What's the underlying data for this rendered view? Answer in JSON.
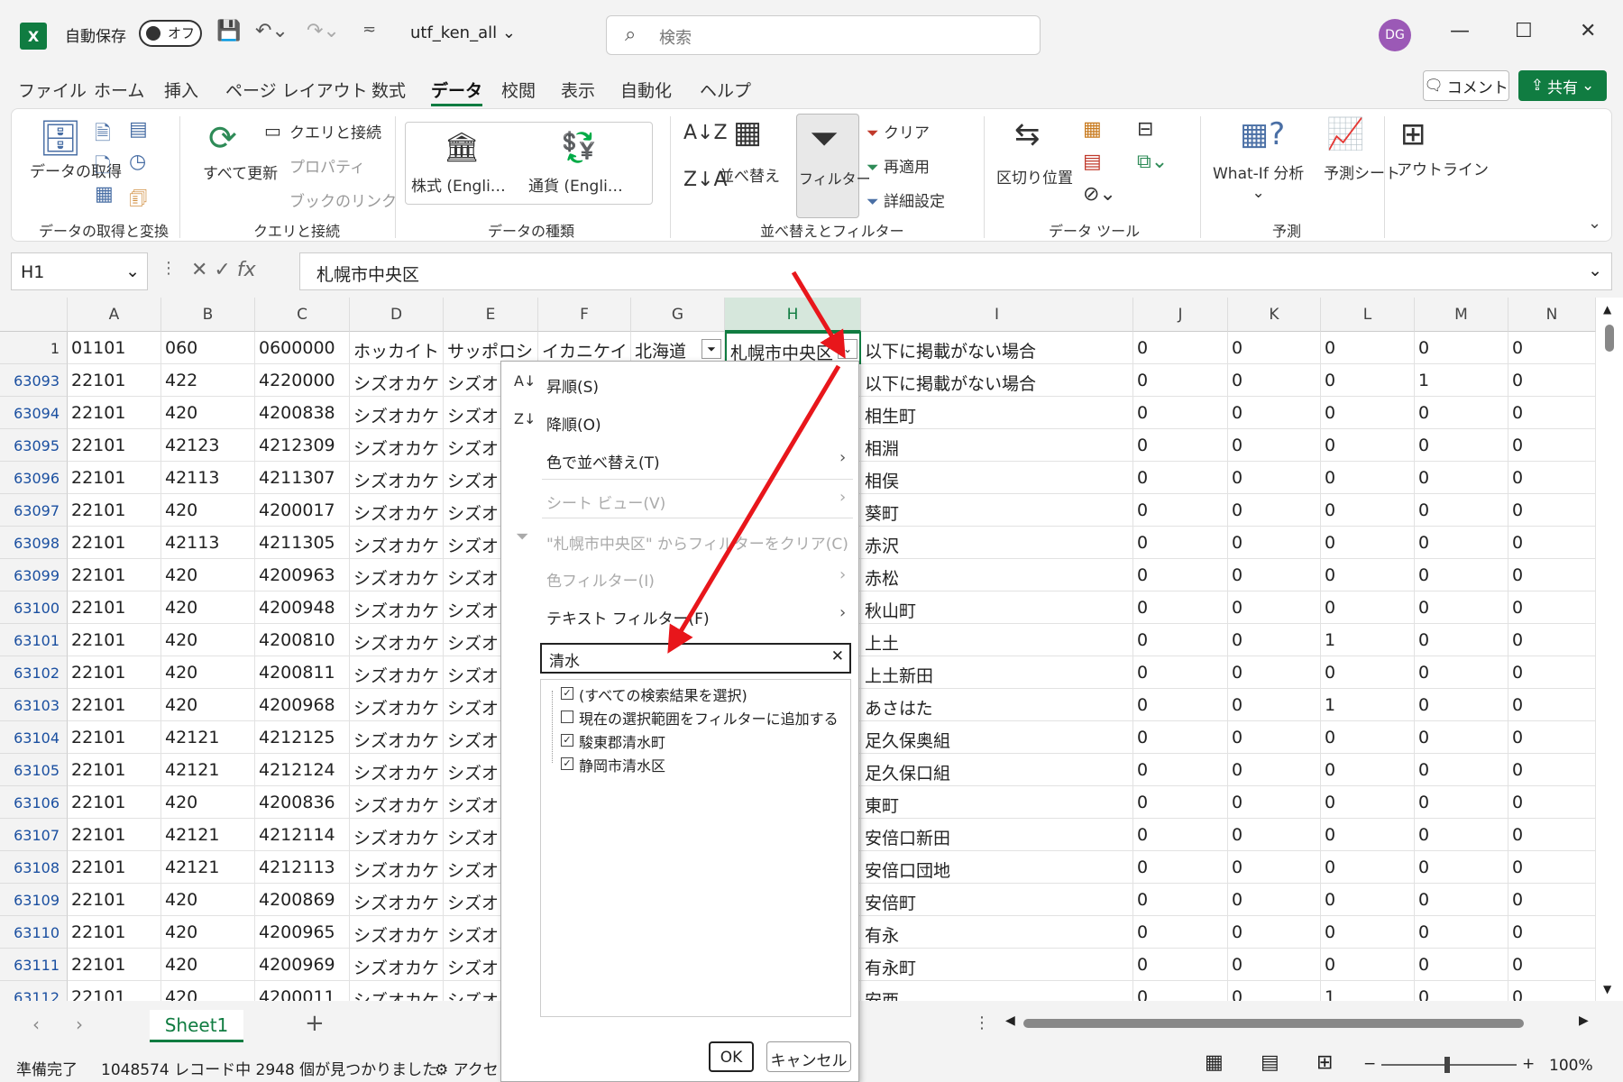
{
  "titlebar": {
    "autosave_label": "自動保存",
    "toggle_label": "オフ",
    "filename": "utf_ken_all",
    "search_placeholder": "検索",
    "avatar": "DG"
  },
  "menu": [
    "ファイル",
    "ホーム",
    "挿入",
    "ページ レイアウト",
    "数式",
    "データ",
    "校閲",
    "表示",
    "自動化",
    "ヘルプ"
  ],
  "menu_active": "データ",
  "buttons": {
    "comment": "コメント",
    "share": "共有"
  },
  "ribbon": {
    "groups": [
      "データの取得と変換",
      "クエリと接続",
      "データの種類",
      "並べ替えとフィルター",
      "データ ツール",
      "予測"
    ],
    "get_data": "データの取得",
    "refresh_all": "すべて更新",
    "queries": "クエリと接続",
    "properties": "プロパティ",
    "book_links": "ブックのリンク",
    "stocks": "株式 (Engli…",
    "currency": "通貨 (Engli…",
    "sort": "並べ替え",
    "filter": "フィルター",
    "clear": "クリア",
    "reapply": "再適用",
    "advanced": "詳細設定",
    "text_to_columns": "区切り位置",
    "whatif": "What-If 分析",
    "forecast": "予測シート",
    "outline": "アウトライン"
  },
  "formula_bar": {
    "name_box": "H1",
    "content": "札幌市中央区"
  },
  "columns": [
    "A",
    "B",
    "C",
    "D",
    "E",
    "F",
    "G",
    "H",
    "I",
    "J",
    "K",
    "L",
    "M",
    "N"
  ],
  "header_row": {
    "num": "1",
    "cells": [
      "01101",
      "060",
      "0600000",
      "ホッカイト",
      "サッポロシ",
      "イカニケイ",
      "北海道",
      "札幌市中央区",
      "以下に掲載がない場合",
      "0",
      "0",
      "0",
      "0",
      "0"
    ]
  },
  "rows": [
    {
      "num": "63093",
      "a": "22101",
      "b": "422",
      "c": "4220000",
      "d": "シズオカケ",
      "e": "シズオ",
      "i": "以下に掲載がない場合",
      "j": "0",
      "k": "0",
      "l": "0",
      "m": "1",
      "n": "0"
    },
    {
      "num": "63094",
      "a": "22101",
      "b": "420",
      "c": "4200838",
      "d": "シズオカケ",
      "e": "シズオ",
      "i": "相生町",
      "j": "0",
      "k": "0",
      "l": "0",
      "m": "0",
      "n": "0"
    },
    {
      "num": "63095",
      "a": "22101",
      "b": "42123",
      "c": "4212309",
      "d": "シズオカケ",
      "e": "シズオ",
      "i": "相淵",
      "j": "0",
      "k": "0",
      "l": "0",
      "m": "0",
      "n": "0"
    },
    {
      "num": "63096",
      "a": "22101",
      "b": "42113",
      "c": "4211307",
      "d": "シズオカケ",
      "e": "シズオ",
      "i": "相俣",
      "j": "0",
      "k": "0",
      "l": "0",
      "m": "0",
      "n": "0"
    },
    {
      "num": "63097",
      "a": "22101",
      "b": "420",
      "c": "4200017",
      "d": "シズオカケ",
      "e": "シズオ",
      "i": "葵町",
      "j": "0",
      "k": "0",
      "l": "0",
      "m": "0",
      "n": "0"
    },
    {
      "num": "63098",
      "a": "22101",
      "b": "42113",
      "c": "4211305",
      "d": "シズオカケ",
      "e": "シズオ",
      "i": "赤沢",
      "j": "0",
      "k": "0",
      "l": "0",
      "m": "0",
      "n": "0"
    },
    {
      "num": "63099",
      "a": "22101",
      "b": "420",
      "c": "4200963",
      "d": "シズオカケ",
      "e": "シズオ",
      "i": "赤松",
      "j": "0",
      "k": "0",
      "l": "0",
      "m": "0",
      "n": "0"
    },
    {
      "num": "63100",
      "a": "22101",
      "b": "420",
      "c": "4200948",
      "d": "シズオカケ",
      "e": "シズオ",
      "i": "秋山町",
      "j": "0",
      "k": "0",
      "l": "0",
      "m": "0",
      "n": "0"
    },
    {
      "num": "63101",
      "a": "22101",
      "b": "420",
      "c": "4200810",
      "d": "シズオカケ",
      "e": "シズオ",
      "i": "上土",
      "j": "0",
      "k": "0",
      "l": "1",
      "m": "0",
      "n": "0"
    },
    {
      "num": "63102",
      "a": "22101",
      "b": "420",
      "c": "4200811",
      "d": "シズオカケ",
      "e": "シズオ",
      "i": "上土新田",
      "j": "0",
      "k": "0",
      "l": "0",
      "m": "0",
      "n": "0"
    },
    {
      "num": "63103",
      "a": "22101",
      "b": "420",
      "c": "4200968",
      "d": "シズオカケ",
      "e": "シズオ",
      "i": "あさはた",
      "j": "0",
      "k": "0",
      "l": "1",
      "m": "0",
      "n": "0"
    },
    {
      "num": "63104",
      "a": "22101",
      "b": "42121",
      "c": "4212125",
      "d": "シズオカケ",
      "e": "シズオ",
      "i": "足久保奥組",
      "j": "0",
      "k": "0",
      "l": "0",
      "m": "0",
      "n": "0"
    },
    {
      "num": "63105",
      "a": "22101",
      "b": "42121",
      "c": "4212124",
      "d": "シズオカケ",
      "e": "シズオ",
      "i": "足久保口組",
      "j": "0",
      "k": "0",
      "l": "0",
      "m": "0",
      "n": "0"
    },
    {
      "num": "63106",
      "a": "22101",
      "b": "420",
      "c": "4200836",
      "d": "シズオカケ",
      "e": "シズオ",
      "i": "東町",
      "j": "0",
      "k": "0",
      "l": "0",
      "m": "0",
      "n": "0"
    },
    {
      "num": "63107",
      "a": "22101",
      "b": "42121",
      "c": "4212114",
      "d": "シズオカケ",
      "e": "シズオ",
      "i": "安倍口新田",
      "j": "0",
      "k": "0",
      "l": "0",
      "m": "0",
      "n": "0"
    },
    {
      "num": "63108",
      "a": "22101",
      "b": "42121",
      "c": "4212113",
      "d": "シズオカケ",
      "e": "シズオ",
      "i": "安倍口団地",
      "j": "0",
      "k": "0",
      "l": "0",
      "m": "0",
      "n": "0"
    },
    {
      "num": "63109",
      "a": "22101",
      "b": "420",
      "c": "4200869",
      "d": "シズオカケ",
      "e": "シズオ",
      "i": "安倍町",
      "j": "0",
      "k": "0",
      "l": "0",
      "m": "0",
      "n": "0"
    },
    {
      "num": "63110",
      "a": "22101",
      "b": "420",
      "c": "4200965",
      "d": "シズオカケ",
      "e": "シズオ",
      "i": "有永",
      "j": "0",
      "k": "0",
      "l": "0",
      "m": "0",
      "n": "0"
    },
    {
      "num": "63111",
      "a": "22101",
      "b": "420",
      "c": "4200969",
      "d": "シズオカケ",
      "e": "シズオ",
      "i": "有永町",
      "j": "0",
      "k": "0",
      "l": "0",
      "m": "0",
      "n": "0"
    },
    {
      "num": "63112",
      "a": "22101",
      "b": "420",
      "c": "4200011",
      "d": "シズオカケ",
      "e": "シズオ",
      "i": "安西",
      "j": "0",
      "k": "0",
      "l": "1",
      "m": "0",
      "n": "0"
    }
  ],
  "dropdown": {
    "sort_asc": "昇順(S)",
    "sort_desc": "降順(O)",
    "sort_color": "色で並べ替え(T)",
    "sheet_view": "シート ビュー(V)",
    "clear_filter": "\"札幌市中央区\" からフィルターをクリア(C)",
    "color_filter": "色フィルター(I)",
    "text_filter": "テキスト フィルター(F)",
    "search_value": "清水",
    "items": [
      {
        "label": "(すべての検索結果を選択)",
        "checked": true
      },
      {
        "label": "現在の選択範囲をフィルターに追加する",
        "checked": false
      },
      {
        "label": "駿東郡清水町",
        "checked": true
      },
      {
        "label": "静岡市清水区",
        "checked": true
      }
    ],
    "ok": "OK",
    "cancel": "キャンセル"
  },
  "sheet_tab": "Sheet1",
  "status": {
    "ready": "準備完了",
    "records": "1048574 レコード中 2948 個が見つかりました",
    "accessibility": "アクセ",
    "zoom": "100%"
  },
  "colors": {
    "accent": "#107c41",
    "arrow": "#e8161b"
  }
}
